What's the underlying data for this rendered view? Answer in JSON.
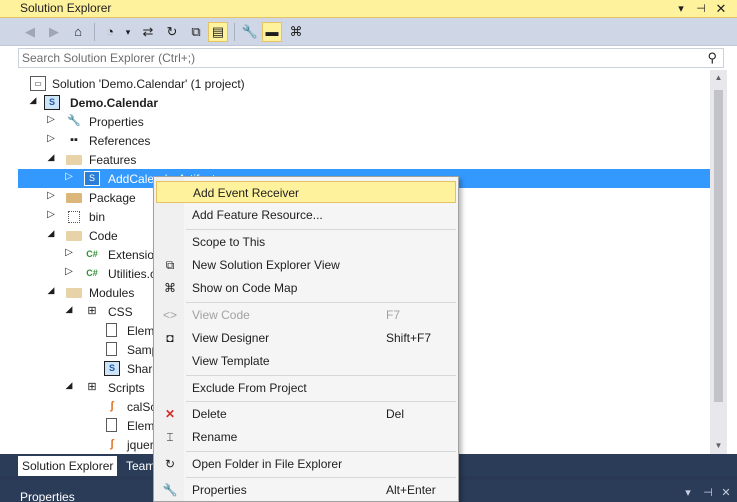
{
  "window": {
    "title": "Solution Explorer"
  },
  "search": {
    "placeholder": "Search Solution Explorer (Ctrl+;)"
  },
  "tree": {
    "rows": [
      {
        "label": "Solution 'Demo.Calendar' (1 project)"
      },
      {
        "label": "Demo.Calendar"
      },
      {
        "label": "Properties"
      },
      {
        "label": "References"
      },
      {
        "label": "Features"
      },
      {
        "label": "AddCalendarArtifacts"
      },
      {
        "label": "Package"
      },
      {
        "label": "bin"
      },
      {
        "label": "Code"
      },
      {
        "label": "Extensions.cs"
      },
      {
        "label": "Utilities.cs"
      },
      {
        "label": "Modules"
      },
      {
        "label": "CSS"
      },
      {
        "label": "Elements.xml"
      },
      {
        "label": "Sample.txt"
      },
      {
        "label": "SharePointProjectItem.spdata"
      },
      {
        "label": "Scripts"
      },
      {
        "label": "calScript.js"
      },
      {
        "label": "Elements.xml"
      },
      {
        "label": "jquery.js"
      }
    ]
  },
  "tabs": {
    "solution_explorer": "Solution Explorer",
    "team": "Team Explorer"
  },
  "properties_panel": {
    "title": "Properties"
  },
  "context_menu": {
    "items": [
      {
        "label": "Add Event Receiver",
        "shortcut": ""
      },
      {
        "label": "Add Feature Resource...",
        "shortcut": ""
      },
      {
        "label": "Scope to This",
        "shortcut": ""
      },
      {
        "label": "New Solution Explorer View",
        "shortcut": ""
      },
      {
        "label": "Show on Code Map",
        "shortcut": ""
      },
      {
        "label": "View Code",
        "shortcut": "F7"
      },
      {
        "label": "View Designer",
        "shortcut": "Shift+F7"
      },
      {
        "label": "View Template",
        "shortcut": ""
      },
      {
        "label": "Exclude From Project",
        "shortcut": ""
      },
      {
        "label": "Delete",
        "shortcut": "Del"
      },
      {
        "label": "Rename",
        "shortcut": ""
      },
      {
        "label": "Open Folder in File Explorer",
        "shortcut": ""
      },
      {
        "label": "Properties",
        "shortcut": "Alt+Enter"
      }
    ]
  },
  "colors": {
    "title_active": "#fff29d",
    "selection": "#3399ff",
    "toolbar": "#cfd6e5",
    "tab_bar": "#2b3c59"
  }
}
